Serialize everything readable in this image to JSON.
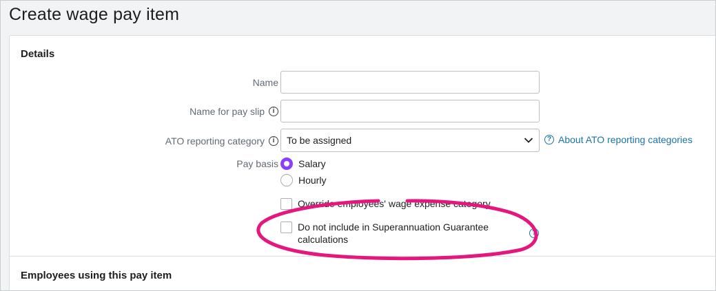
{
  "page": {
    "title": "Create wage pay item"
  },
  "details": {
    "section_title": "Details",
    "name": {
      "label": "Name",
      "value": "",
      "placeholder": ""
    },
    "payslip_name": {
      "label": "Name for pay slip",
      "value": "",
      "placeholder": ""
    },
    "ato_category": {
      "label": "ATO reporting category",
      "selected": "To be assigned",
      "help_link": "About ATO reporting categories"
    },
    "pay_basis": {
      "label": "Pay basis",
      "options": [
        "Salary",
        "Hourly"
      ],
      "selected": "Salary"
    },
    "override_checkbox": {
      "label": "Override employees' wage expense category",
      "checked": false
    },
    "sg_checkbox": {
      "label_line1": "Do not include in Superannuation Guarantee",
      "label_line2": "calculations",
      "checked": false
    }
  },
  "employees_section": {
    "title": "Employees using this pay item"
  },
  "colors": {
    "accent_radio": "#8a3ffc",
    "link": "#1a73a8",
    "annotation": "#e5177e"
  },
  "icons": [
    "info-icon",
    "chevron-down-icon",
    "help-circle-icon"
  ]
}
